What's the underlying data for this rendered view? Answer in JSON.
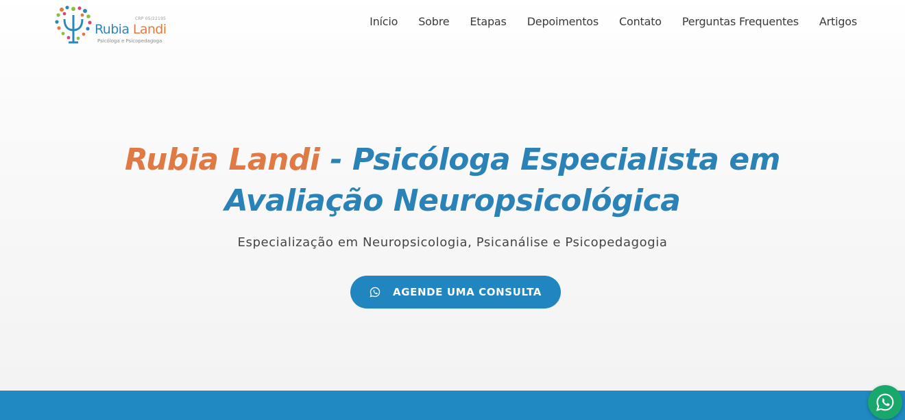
{
  "brand": {
    "crp": "CRP 05/22195",
    "first_name": "Rubia",
    "last_name": "Landi",
    "subtitle": "Psicóloga e Psicopedagoga",
    "colors": {
      "blue": "#2d86b9",
      "orange": "#e2793e"
    }
  },
  "nav": {
    "items": [
      {
        "label": "Início"
      },
      {
        "label": "Sobre"
      },
      {
        "label": "Etapas"
      },
      {
        "label": "Depoimentos"
      },
      {
        "label": "Contato"
      },
      {
        "label": "Perguntas Frequentes"
      },
      {
        "label": "Artigos"
      }
    ]
  },
  "hero": {
    "title_name": "Rubia Landi",
    "title_rest_line1": " - Psicóloga Especialista em",
    "title_line2": "Avaliação Neuropsicológica",
    "subtitle": "Especialização em Neuropsicologia, Psicanálise e Psicopedagogia",
    "cta_label": "AGENDE UMA CONSULTA",
    "cta_icon": "whatsapp-icon"
  },
  "floating": {
    "icon": "whatsapp-icon",
    "color": "#18a86b"
  },
  "colors": {
    "accent": "#2186c0",
    "band": "#2089c2",
    "title_orange": "#e07a45",
    "title_blue": "#2a82b6"
  }
}
